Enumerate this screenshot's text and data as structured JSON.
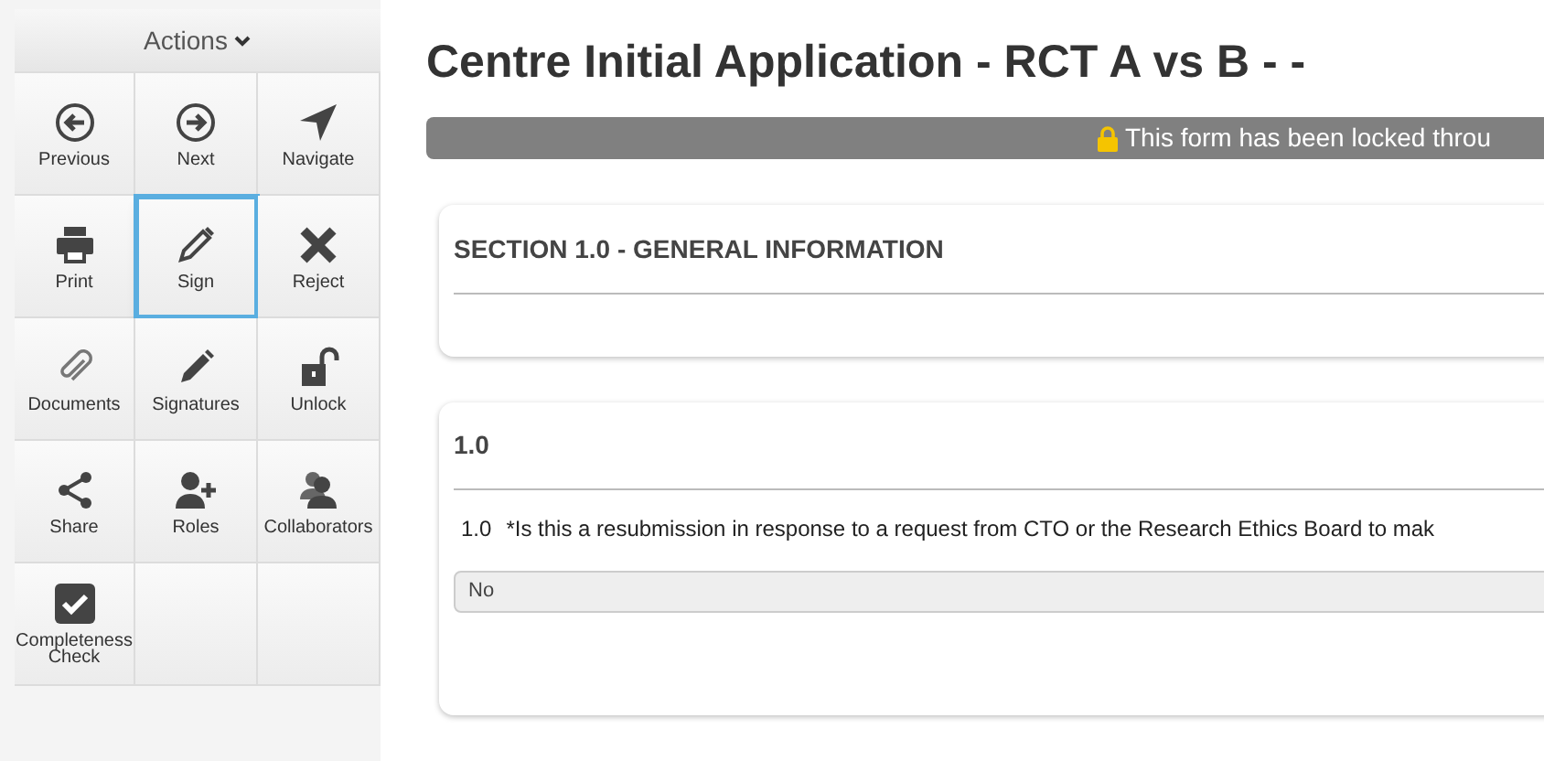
{
  "sidebar": {
    "header": "Actions",
    "actions": [
      {
        "label": "Previous",
        "selected": false
      },
      {
        "label": "Next",
        "selected": false
      },
      {
        "label": "Navigate",
        "selected": false
      },
      {
        "label": "Print",
        "selected": false
      },
      {
        "label": "Sign",
        "selected": true
      },
      {
        "label": "Reject",
        "selected": false
      },
      {
        "label": "Documents",
        "selected": false
      },
      {
        "label": "Signatures",
        "selected": false
      },
      {
        "label": "Unlock",
        "selected": false
      },
      {
        "label": "Share",
        "selected": false
      },
      {
        "label": "Roles",
        "selected": false
      },
      {
        "label": "Collaborators",
        "selected": false
      },
      {
        "label": "Completeness Check",
        "selected": false
      }
    ]
  },
  "page": {
    "title": "Centre Initial Application - RCT A vs B - -",
    "lock_banner": "This form has been locked throu",
    "sections": [
      {
        "heading": "SECTION 1.0 - GENERAL INFORMATION"
      },
      {
        "heading": "1.0",
        "question_number": "1.0",
        "question": "*Is this a resubmission in response to a request from CTO or the Research Ethics Board to mak",
        "answer": "No"
      }
    ]
  }
}
